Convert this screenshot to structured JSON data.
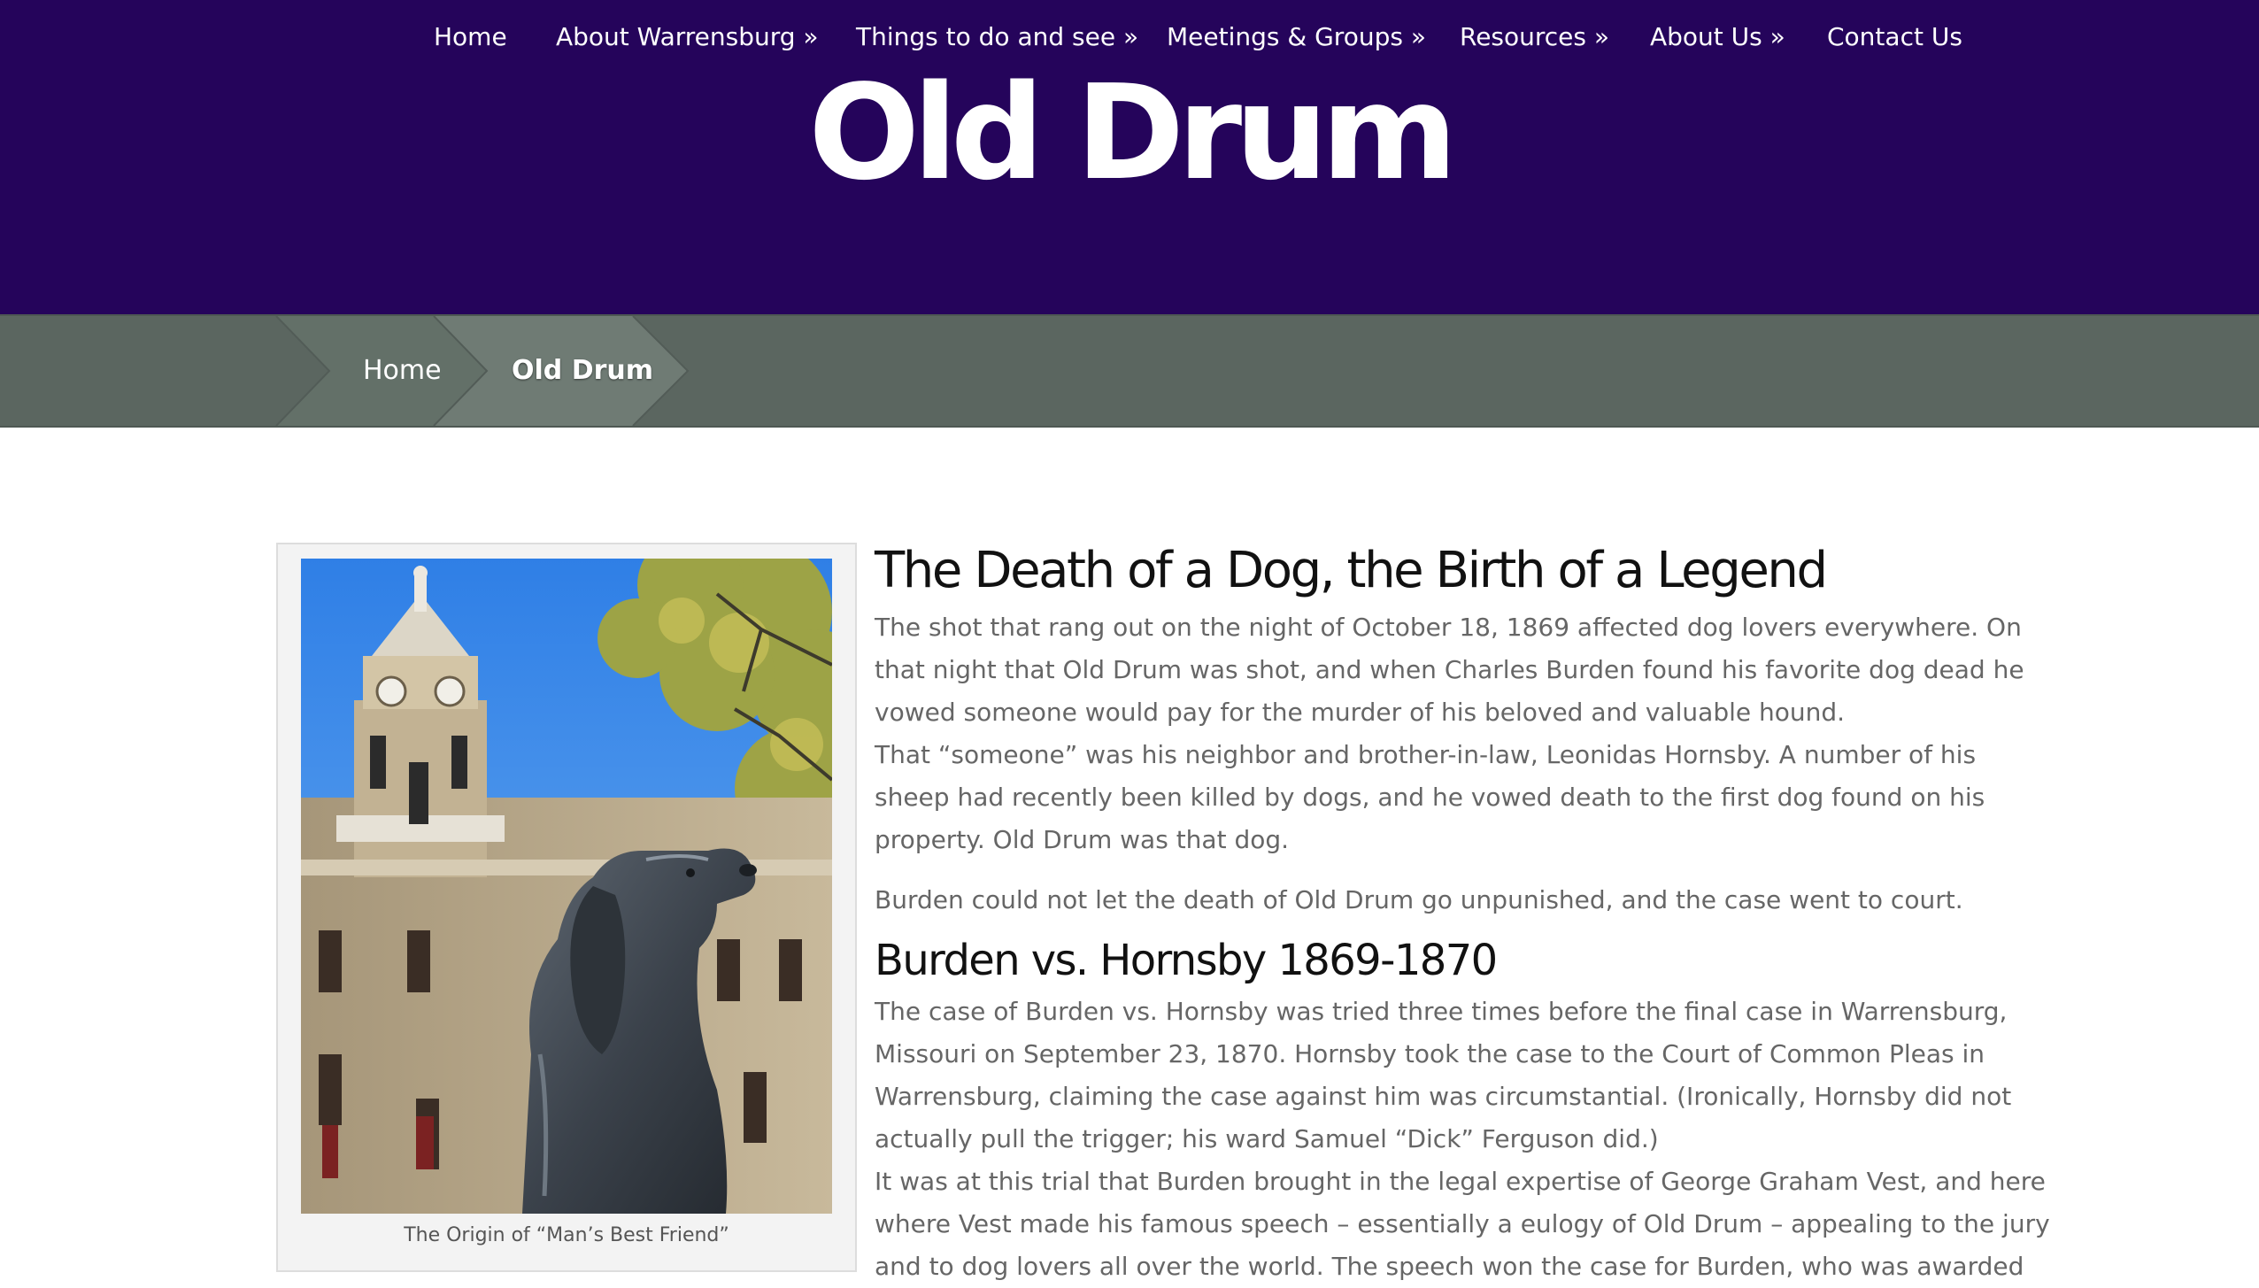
{
  "nav": {
    "items": [
      {
        "label": "Home"
      },
      {
        "label": "About Warrensburg »"
      },
      {
        "label": "Things to do and see »"
      },
      {
        "label": "Meetings & Groups »"
      },
      {
        "label": "Resources »"
      },
      {
        "label": "About Us »"
      },
      {
        "label": "Contact Us"
      }
    ]
  },
  "header": {
    "title": "Old Drum"
  },
  "breadcrumb": {
    "home": "Home",
    "current": "Old Drum"
  },
  "figure": {
    "caption": "The Origin of “Man’s Best Friend”"
  },
  "article": {
    "heading1": "The Death of a Dog, the Birth of a Legend",
    "para1": [
      "The shot that rang out on the night of October 18, 1869 affected dog lovers everywhere. On",
      "that night that Old Drum was shot, and when Charles Burden found his favorite dog dead he",
      "vowed someone would pay for the murder of his beloved and valuable hound."
    ],
    "para2": [
      "That “someone” was his neighbor and brother-in-law, Leonidas Hornsby. A number of his",
      "sheep had recently been killed by dogs, and he vowed death to the first dog found on his",
      "property. Old Drum was that dog."
    ],
    "para3": [
      "Burden could not let the death of Old Drum go unpunished, and the case went to court."
    ],
    "heading2": "Burden vs. Hornsby 1869-1870",
    "para4": [
      "The case of Burden vs. Hornsby was tried three times before the final case in Warrensburg,",
      "Missouri on September 23, 1870. Hornsby took the case to the Court of Common Pleas in",
      "Warrensburg, claiming the case against him was circumstantial. (Ironically, Hornsby did not",
      "actually pull the trigger; his ward Samuel “Dick” Ferguson did.)"
    ],
    "para5": [
      "It was at this trial that Burden brought in the legal expertise of George Graham Vest, and here",
      "where Vest made his famous speech – essentially a eulogy of Old Drum – appealing to the jury",
      "and to dog lovers all over the world. The speech won the case for Burden, who was awarded"
    ]
  }
}
